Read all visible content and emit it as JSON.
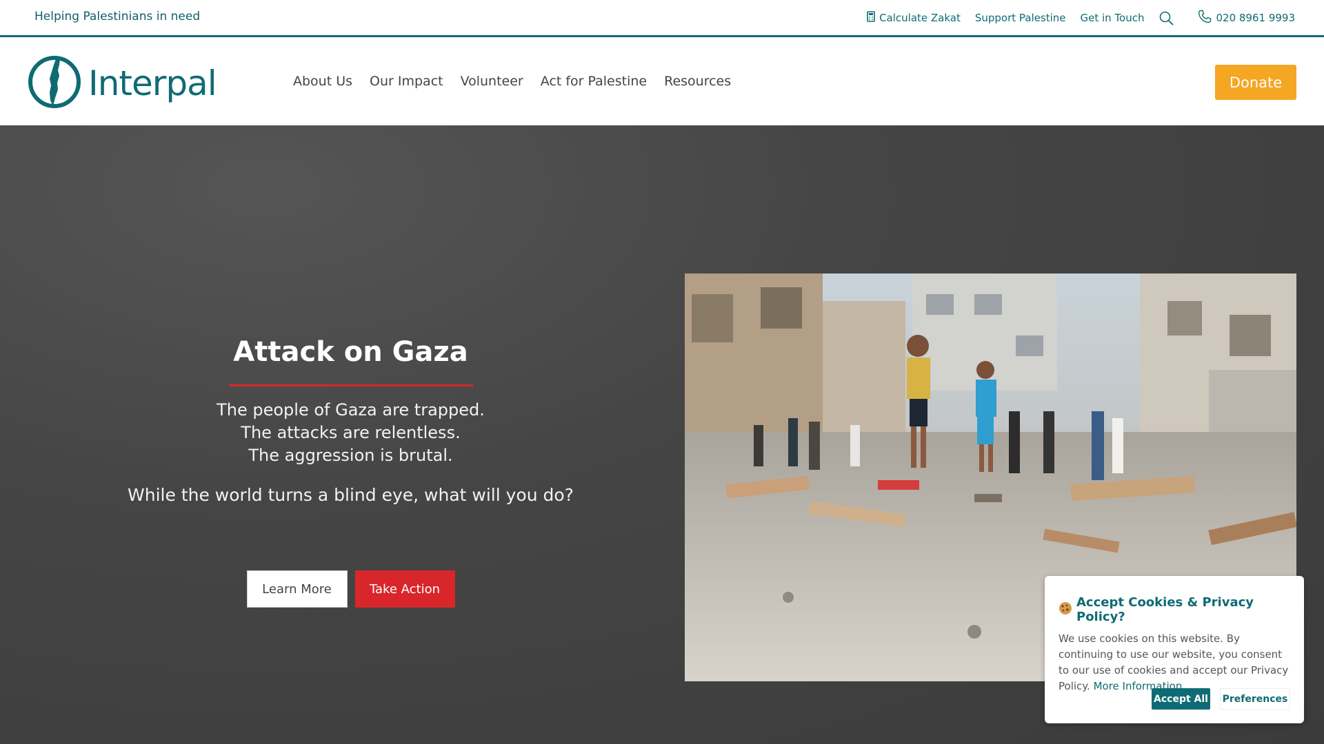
{
  "topbar": {
    "tagline": "Helping Palestinians in need",
    "links": {
      "zakat": "Calculate Zakat",
      "support": "Support Palestine",
      "contact": "Get in Touch",
      "phone": "020 8961 9993"
    }
  },
  "header": {
    "logo_text": "Interpal",
    "nav": {
      "about": "About Us",
      "impact": "Our Impact",
      "volunteer": "Volunteer",
      "act": "Act for Palestine",
      "resources": "Resources"
    },
    "donate": "Donate"
  },
  "hero": {
    "title": "Attack on Gaza",
    "lines": [
      "The people of Gaza are trapped.",
      "The attacks are relentless.",
      "The aggression is brutal."
    ],
    "question": "While the world turns a blind eye, what will you do?",
    "learn_more": "Learn More",
    "take_action": "Take Action"
  },
  "cookie": {
    "title": "Accept Cookies & Privacy Policy?",
    "text": "We use cookies on this website. By continuing to use our website, you consent to our use of cookies and accept our Privacy Policy.",
    "more": "More Information",
    "accept": "Accept All",
    "preferences": "Preferences"
  },
  "colors": {
    "brand": "#0f6b73",
    "donate": "#f5a623",
    "action": "#d9262b",
    "hero_bg": "#454545"
  },
  "icons": [
    "calculator-icon",
    "search-icon",
    "phone-icon",
    "logo-map-icon",
    "cookie-icon"
  ]
}
